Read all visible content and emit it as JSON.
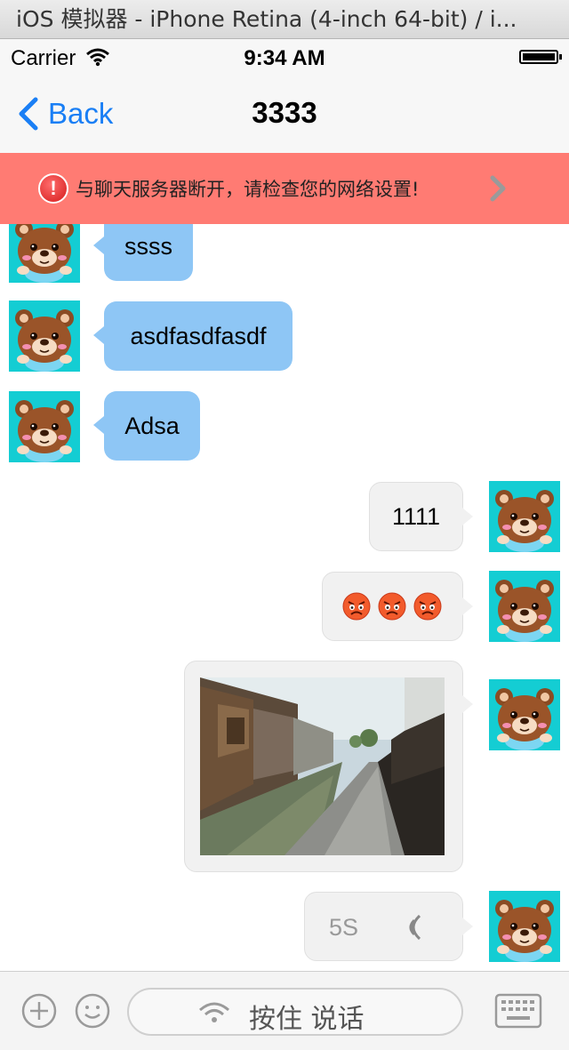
{
  "window": {
    "title": "iOS 模拟器 - iPhone Retina (4-inch 64-bit) / i..."
  },
  "status_bar": {
    "carrier": "Carrier",
    "time": "9:34 AM"
  },
  "nav": {
    "back_label": "Back",
    "title": "3333"
  },
  "alert": {
    "message": "与聊天服务器断开，请检查您的网络设置!"
  },
  "messages": [
    {
      "side": "left",
      "type": "text",
      "text": "ssss"
    },
    {
      "side": "left",
      "type": "text",
      "text": "asdfasdfasdf"
    },
    {
      "side": "left",
      "type": "text",
      "text": "Adsa"
    },
    {
      "side": "right",
      "type": "text",
      "text": "1111"
    },
    {
      "side": "right",
      "type": "emoji",
      "emoji": [
        "angry-face-icon",
        "angry-face-icon",
        "angry-face-icon"
      ]
    },
    {
      "side": "right",
      "type": "image",
      "description": "canal-town-photo"
    },
    {
      "side": "right",
      "type": "voice",
      "duration": "5S"
    }
  ],
  "toolbar": {
    "talk_label": "按住 说话"
  },
  "colors": {
    "alert_bg": "#ff7b73",
    "left_bubble": "#8ec6f5",
    "right_bubble": "#f1f1f1",
    "avatar_bg": "#14cdd3",
    "accent": "#1a7ff5"
  }
}
